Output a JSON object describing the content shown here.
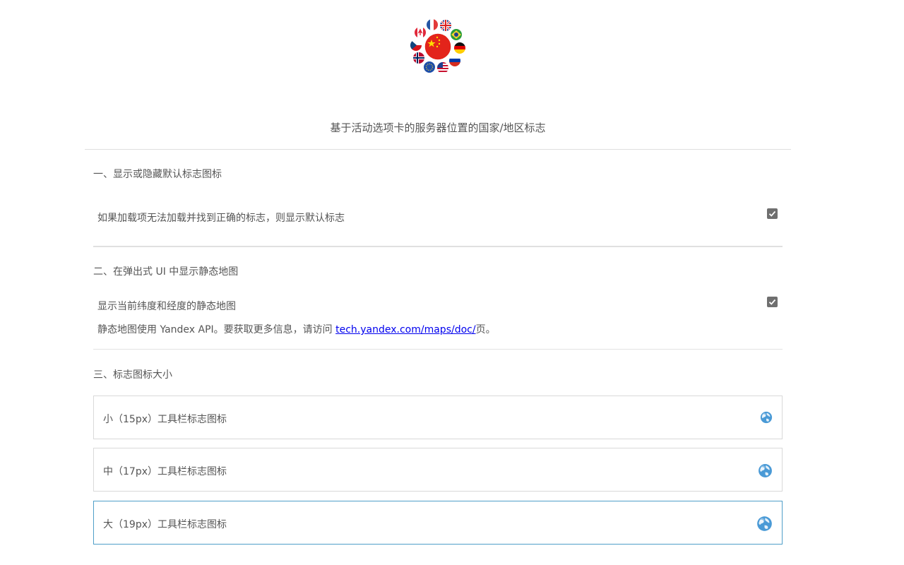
{
  "header": {
    "logo_icon": "country-flags-globe-icon",
    "title": "基于活动选项卡的服务器位置的国家/地区标志"
  },
  "sections": [
    {
      "heading": "一、显示或隐藏默认标志图标",
      "option_text": "如果加载项无法加载并找到正确的标志，则显示默认标志",
      "checked": true
    },
    {
      "heading": "二、在弹出式 UI 中显示静态地图",
      "option_text": "显示当前纬度和经度的静态地图",
      "checked": true,
      "note_before": "静态地图使用 Yandex API。要获取更多信息，请访问 ",
      "note_link": "tech.yandex.com/maps/doc/",
      "note_after": "页。"
    },
    {
      "heading": "三、标志图标大小",
      "options": [
        {
          "label": "小（15px）工具栏标志图标",
          "icon": "globe-icon",
          "selected": false
        },
        {
          "label": "中（17px）工具栏标志图标",
          "icon": "globe-icon",
          "selected": false
        },
        {
          "label": "大（19px）工具栏标志图标",
          "icon": "globe-icon",
          "selected": true
        }
      ]
    }
  ],
  "colors": {
    "text": "#555555",
    "checkbox": "#6f6f6f",
    "selected_border": "#4f9ec8",
    "link": "#0000ee"
  }
}
